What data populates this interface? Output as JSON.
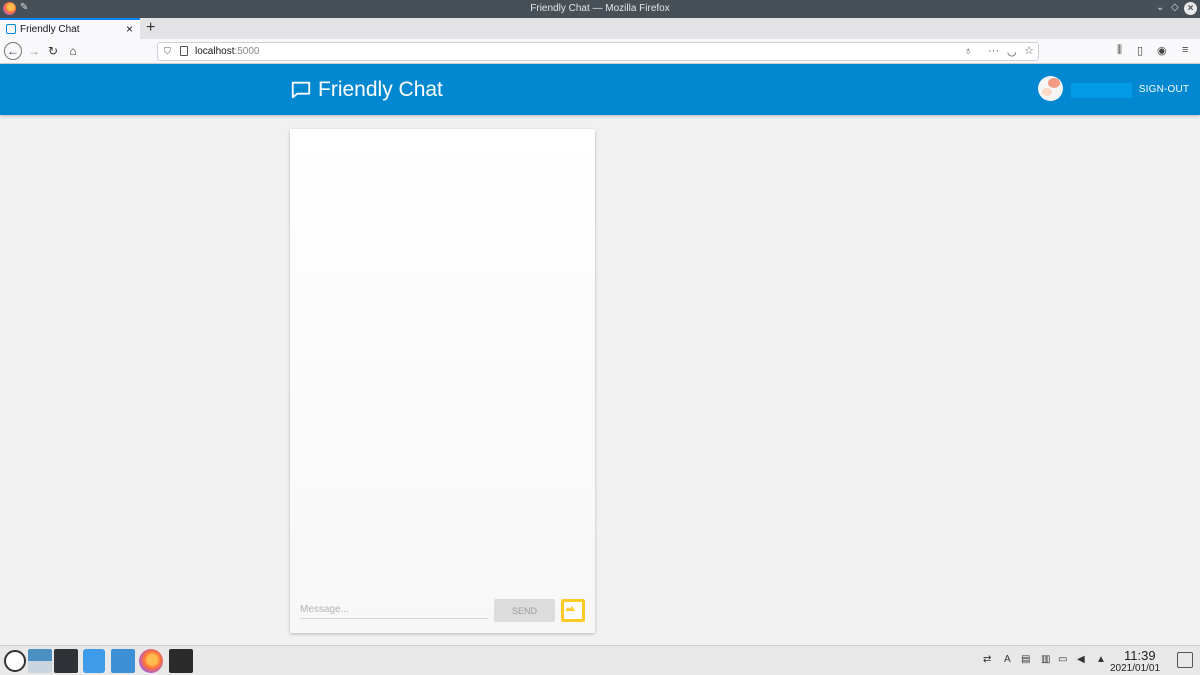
{
  "window": {
    "title": "Friendly Chat — Mozilla Firefox"
  },
  "browser": {
    "tab_title": "Friendly Chat",
    "new_tab_symbol": "+",
    "url_host": "localhost",
    "url_port": ":5000"
  },
  "app": {
    "title": "Friendly Chat",
    "sign_out_label": "SIGN-OUT",
    "accent_color": "#0288d1"
  },
  "composer": {
    "message_placeholder": "Message...",
    "send_label": "SEND"
  },
  "taskbar": {
    "time": "11:39",
    "date": "2021/01/01",
    "keyboard_layout": "A"
  }
}
